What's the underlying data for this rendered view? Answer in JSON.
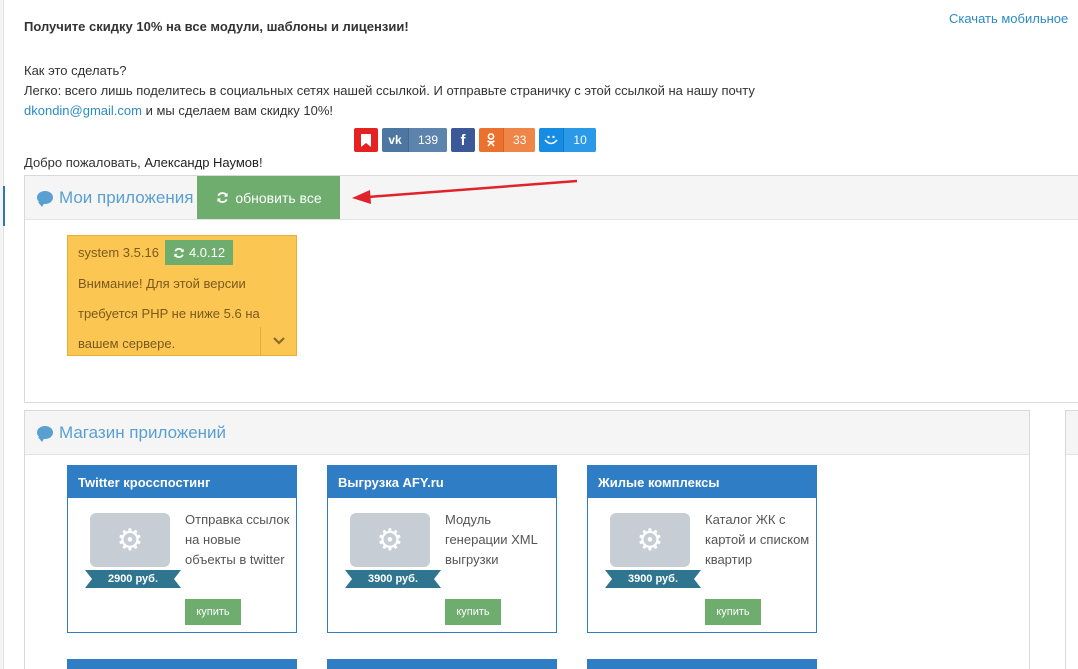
{
  "promo": {
    "title": "Получите скидку 10% на все модули, шаблоны и лицензии!",
    "mobile_link": "Скачать мобильное",
    "how_q": "Как это сделать?",
    "how_text": "Легко: всего лишь поделитесь в социальных сетях нашей ссылкой. И отправьте страничку с этой ссылкой на нашу почту",
    "email": "dkondin@gmail.com",
    "how_tail": " и мы сделаем вам скидку 10%!"
  },
  "share": {
    "vk_count": "139",
    "ok_count": "33",
    "mr_count": "10"
  },
  "welcome": {
    "prefix": "Добро пожаловать, ",
    "user": "Александр Наумов",
    "suffix": "!"
  },
  "my_apps": {
    "title": "Мои приложения",
    "update_all": "обновить все",
    "card": {
      "current": "system 3.5.16",
      "new_version": "4.0.12",
      "warning": "Внимание! Для этой версии требуется PHP не ниже 5.6 на вашем сервере."
    }
  },
  "shop": {
    "title": "Магазин приложений",
    "buy_label": "купить",
    "items": [
      {
        "name": "Twitter кросспостинг",
        "price": "2900 руб.",
        "desc": "Отправка ссылок на новые объекты в twitter"
      },
      {
        "name": "Выгрузка AFY.ru",
        "price": "3900 руб.",
        "desc": "Модуль генерации XML выгрузки"
      },
      {
        "name": "Жилые комплексы",
        "price": "3900 руб.",
        "desc": "Каталог ЖК с картой и списком квартир"
      }
    ]
  },
  "colors": {
    "accent": "#5a9fd1",
    "green": "#6fad6f",
    "warning_bg": "#fcc653",
    "card_blue": "#2f7dc4"
  }
}
